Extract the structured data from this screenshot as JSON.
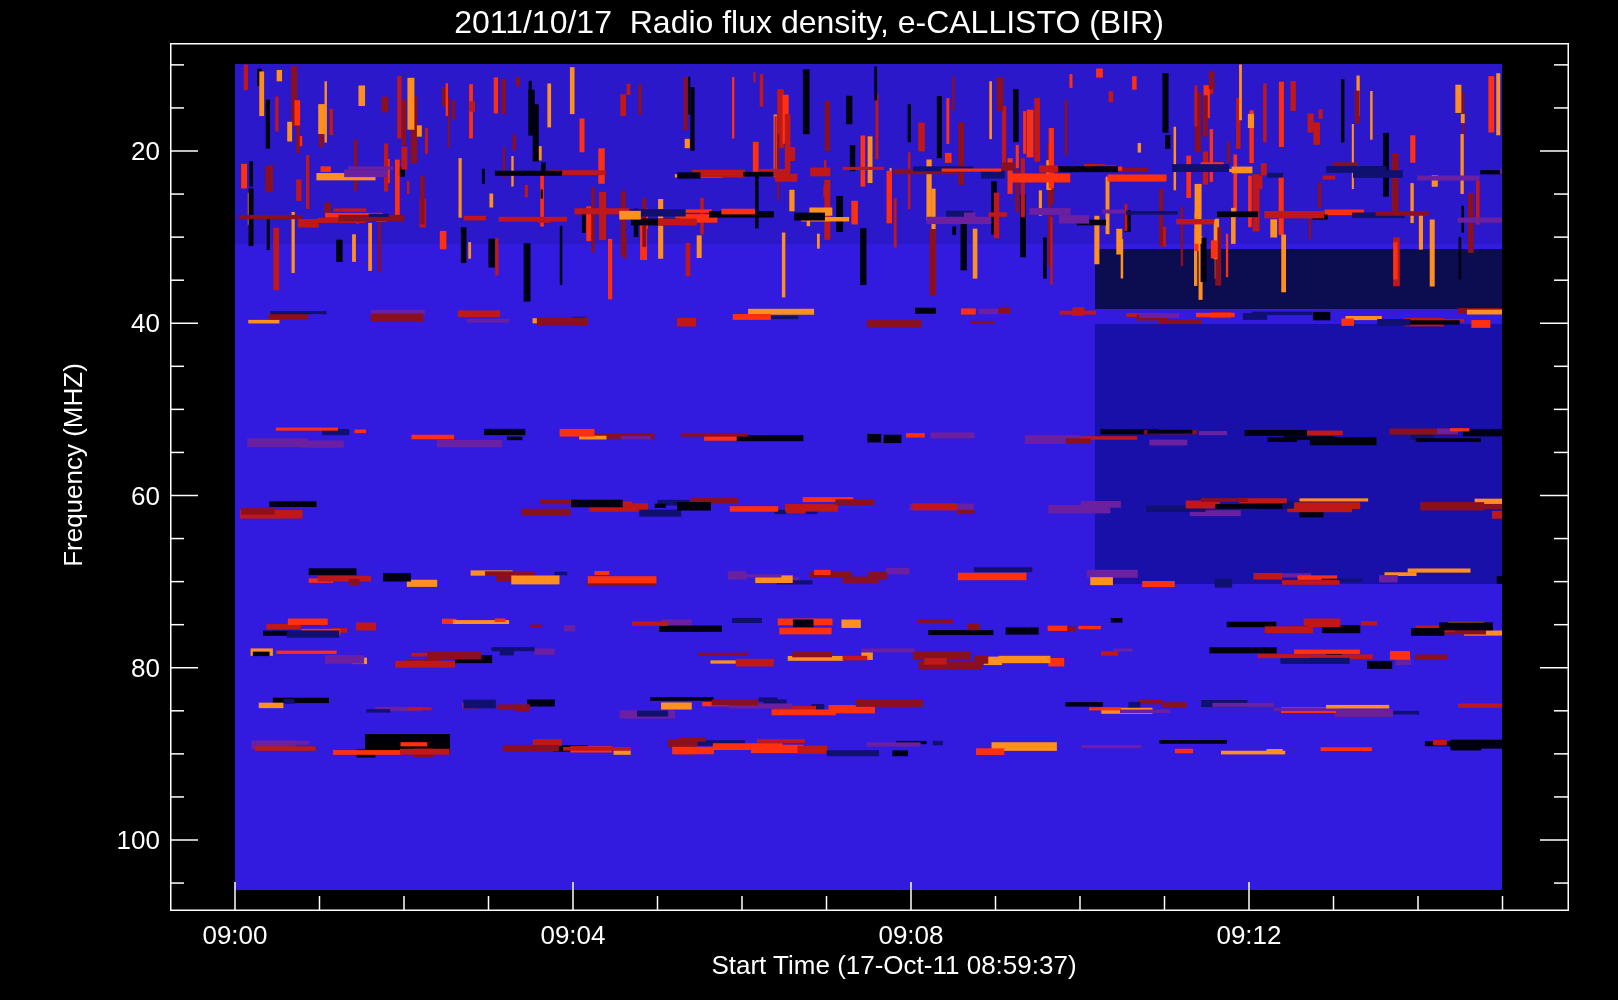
{
  "title": "2011/10/17  Radio flux density, e-CALLISTO (BIR)",
  "y_axis": {
    "label": "Frequency (MHZ)",
    "ticks": [
      "20",
      "40",
      "60",
      "80",
      "100"
    ]
  },
  "x_axis": {
    "label": "Start Time (17-Oct-11 08:59:37)",
    "ticks": [
      "09:00",
      "09:04",
      "09:08",
      "09:12"
    ]
  }
}
